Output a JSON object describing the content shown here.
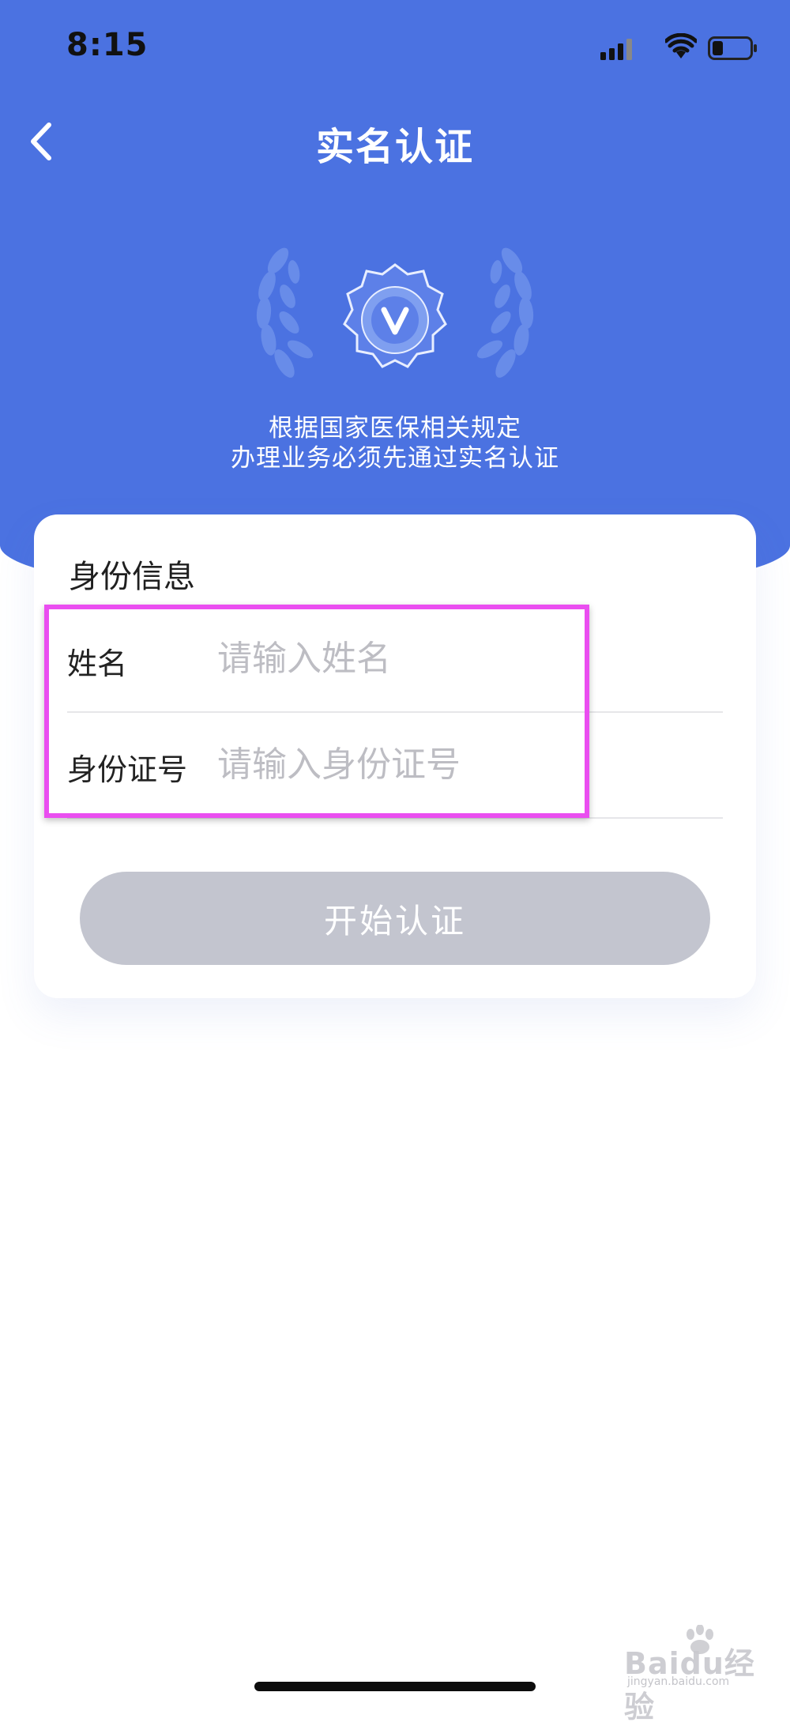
{
  "status_bar": {
    "time": "8:15",
    "icons": [
      "signal-icon",
      "wifi-icon",
      "battery-icon"
    ]
  },
  "header": {
    "title": "实名认证",
    "back_icon": "chevron-left-icon",
    "notice_line1": "根据国家医保相关规定",
    "notice_line2": "办理业务必须先通过实名认证",
    "badge_icon": "verified-badge-icon",
    "background_color": "#4b72e1"
  },
  "form": {
    "section_title": "身份信息",
    "name_label": "姓名",
    "name_placeholder": "请输入姓名",
    "name_value": "",
    "id_label": "身份证号",
    "id_placeholder": "请输入身份证号",
    "id_value": "",
    "submit_label": "开始认证",
    "submit_color": "#c3c5cf"
  },
  "annotation": {
    "highlight_color": "#ea4ef0"
  },
  "watermark": {
    "brand": "Bai",
    "brand_suffix": "du经验",
    "url": "jingyan.baidu.com"
  }
}
